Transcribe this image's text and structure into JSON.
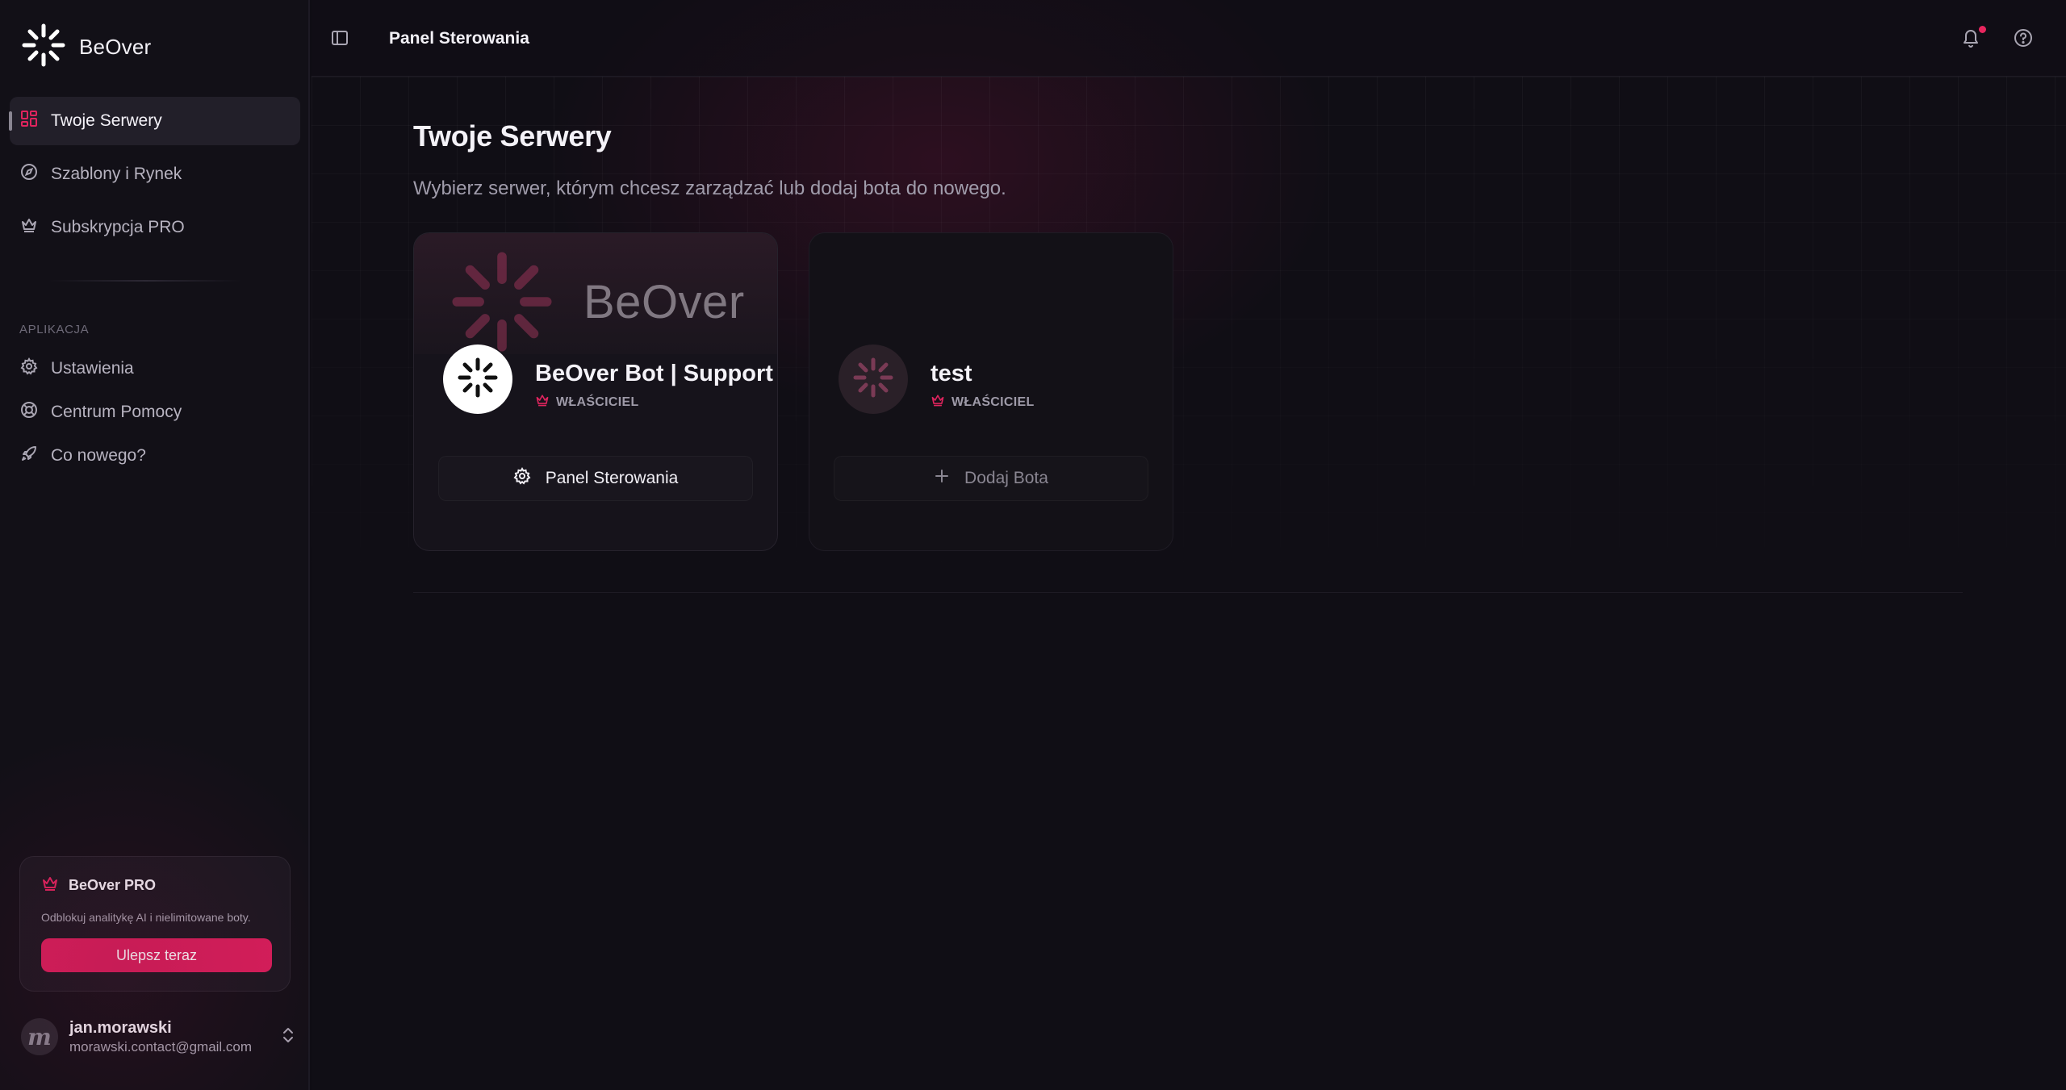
{
  "brand": {
    "name": "BeOver"
  },
  "sidebar": {
    "nav": [
      {
        "label": "Twoje Serwery",
        "icon": "grid-icon",
        "active": true
      },
      {
        "label": "Szablony i Rynek",
        "icon": "compass-icon"
      },
      {
        "label": "Subskrypcja PRO",
        "icon": "crown-icon"
      }
    ],
    "section_label": "APLIKACJA",
    "app_nav": [
      {
        "label": "Ustawienia",
        "icon": "gear-icon"
      },
      {
        "label": "Centrum Pomocy",
        "icon": "lifebuoy-icon"
      },
      {
        "label": "Co nowego?",
        "icon": "rocket-icon"
      }
    ],
    "pro": {
      "title": "BeOver PRO",
      "description": "Odblokuj analitykę AI i nielimitowane boty.",
      "button": "Ulepsz teraz"
    },
    "user": {
      "initial": "m",
      "name": "jan.morawski",
      "email": "morawski.contact@gmail.com"
    }
  },
  "topbar": {
    "title": "Panel Sterowania"
  },
  "main": {
    "title": "Twoje Serwery",
    "subtitle": "Wybierz serwer, którym chcesz zarządzać lub dodaj bota do nowego.",
    "servers": [
      {
        "banner_text": "BeOver",
        "name": "BeOver Bot | Support",
        "role": "WŁAŚCICIEL",
        "action": "Panel Sterowania",
        "action_icon": "gear-icon"
      },
      {
        "name": "test",
        "role": "WŁAŚCICIEL",
        "action": "Dodaj Bota",
        "action_icon": "plus-icon"
      }
    ]
  },
  "colors": {
    "accent": "#d81e5b",
    "background": "#100e15",
    "sidebar": "#121017"
  }
}
